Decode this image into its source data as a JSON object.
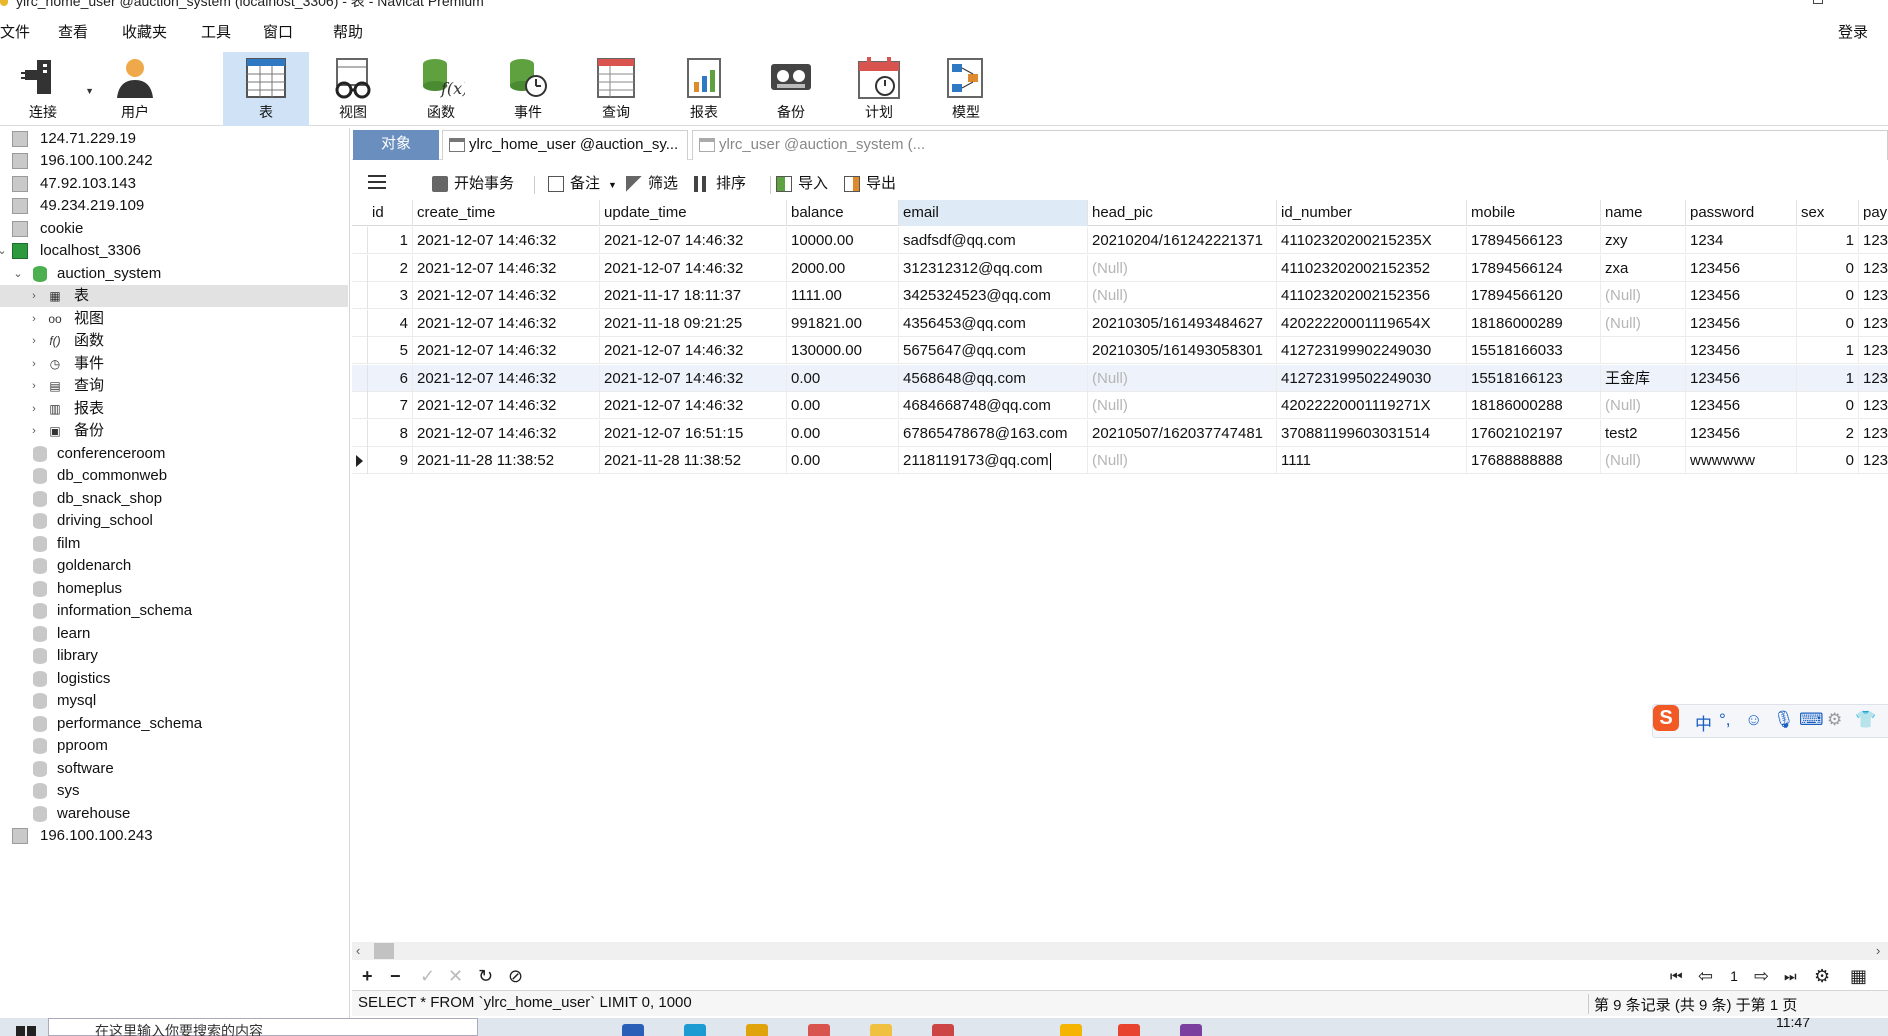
{
  "window": {
    "title": "ylrc_home_user @auction_system (localhost_3306) - 表 - Navicat Premium",
    "login": "登录"
  },
  "menu": [
    "文件",
    "查看",
    "收藏夹",
    "工具",
    "窗口",
    "帮助"
  ],
  "toolbar": [
    {
      "label": "连接",
      "icon": "plug-icon"
    },
    {
      "label": "用户",
      "icon": "user-icon"
    },
    {
      "label": "表",
      "icon": "table-icon",
      "active": true
    },
    {
      "label": "视图",
      "icon": "view-glasses-icon"
    },
    {
      "label": "函数",
      "icon": "function-icon"
    },
    {
      "label": "事件",
      "icon": "event-clock-icon"
    },
    {
      "label": "查询",
      "icon": "query-icon"
    },
    {
      "label": "报表",
      "icon": "report-icon"
    },
    {
      "label": "备份",
      "icon": "backup-icon"
    },
    {
      "label": "计划",
      "icon": "schedule-calendar-icon"
    },
    {
      "label": "模型",
      "icon": "model-icon"
    }
  ],
  "tree": {
    "connections_top": [
      "124.71.229.19",
      "196.100.100.242",
      "47.92.103.143",
      "49.234.219.109",
      "cookie"
    ],
    "active_connection": "localhost_3306",
    "active_db": "auction_system",
    "db_children": [
      "表",
      "视图",
      "函数",
      "事件",
      "查询",
      "报表",
      "备份"
    ],
    "other_dbs": [
      "conferenceroom",
      "db_commonweb",
      "db_snack_shop",
      "driving_school",
      "film",
      "goldenarch",
      "homeplus",
      "information_schema",
      "learn",
      "library",
      "logistics",
      "mysql",
      "performance_schema",
      "pproom",
      "software",
      "sys",
      "warehouse"
    ],
    "connections_bottom": [
      "196.100.100.243"
    ]
  },
  "tabs": {
    "objects": "对象",
    "tab1": "ylrc_home_user @auction_sy...",
    "tab2": "ylrc_user @auction_system (..."
  },
  "table_toolbar": {
    "begin_tx": "开始事务",
    "notes": "备注",
    "filter": "筛选",
    "sort": "排序",
    "import": "导入",
    "export": "导出"
  },
  "grid": {
    "columns": [
      "id",
      "create_time",
      "update_time",
      "balance",
      "email",
      "head_pic",
      "id_number",
      "mobile",
      "name",
      "password",
      "sex",
      "pay"
    ],
    "rows": [
      [
        "1",
        "2021-12-07 14:46:32",
        "2021-12-07 14:46:32",
        "10000.00",
        "sadfsdf@qq.com",
        "20210204/161242221371",
        "41102320200215235X",
        "17894566123",
        "zxy",
        "1234",
        "1",
        "123"
      ],
      [
        "2",
        "2021-12-07 14:46:32",
        "2021-12-07 14:46:32",
        "2000.00",
        "312312312@qq.com",
        "(Null)",
        "411023202002152352",
        "17894566124",
        "zxa",
        "123456",
        "0",
        "123"
      ],
      [
        "3",
        "2021-12-07 14:46:32",
        "2021-11-17 18:11:37",
        "1111.00",
        "3425324523@qq.com",
        "(Null)",
        "411023202002152356",
        "17894566120",
        "(Null)",
        "123456",
        "0",
        "123"
      ],
      [
        "4",
        "2021-12-07 14:46:32",
        "2021-11-18 09:21:25",
        "991821.00",
        "4356453@qq.com",
        "20210305/161493484627",
        "42022220001119654X",
        "18186000289",
        "(Null)",
        "123456",
        "0",
        "123"
      ],
      [
        "5",
        "2021-12-07 14:46:32",
        "2021-12-07 14:46:32",
        "130000.00",
        "5675647@qq.com",
        "20210305/161493058301",
        "412723199902249030",
        "15518166033",
        "",
        "123456",
        "1",
        "123"
      ],
      [
        "6",
        "2021-12-07 14:46:32",
        "2021-12-07 14:46:32",
        "0.00",
        "4568648@qq.com",
        "(Null)",
        "412723199502249030",
        "15518166123",
        "王金库",
        "123456",
        "1",
        "123"
      ],
      [
        "7",
        "2021-12-07 14:46:32",
        "2021-12-07 14:46:32",
        "0.00",
        "4684668748@qq.com",
        "(Null)",
        "42022220001119271X",
        "18186000288",
        "(Null)",
        "123456",
        "0",
        "123"
      ],
      [
        "8",
        "2021-12-07 14:46:32",
        "2021-12-07 16:51:15",
        "0.00",
        "67865478678@163.com",
        "20210507/162037747481",
        "370881199603031514",
        "17602102197",
        "test2",
        "123456",
        "2",
        "123"
      ],
      [
        "9",
        "2021-11-28 11:38:52",
        "2021-11-28 11:38:52",
        "0.00",
        "2118119173@qq.com",
        "(Null)",
        "1111",
        "17688888888",
        "(Null)",
        "wwwwww",
        "0",
        "123"
      ]
    ]
  },
  "ime": {
    "mode": "中"
  },
  "nav": {
    "page": "1"
  },
  "status": {
    "sql": "SELECT * FROM `ylrc_home_user` LIMIT 0, 1000",
    "records": "第 9 条记录 (共 9 条) 于第 1 页"
  },
  "taskbar": {
    "search_placeholder": "在这里输入你要搜索的内容",
    "time": "11:47"
  }
}
